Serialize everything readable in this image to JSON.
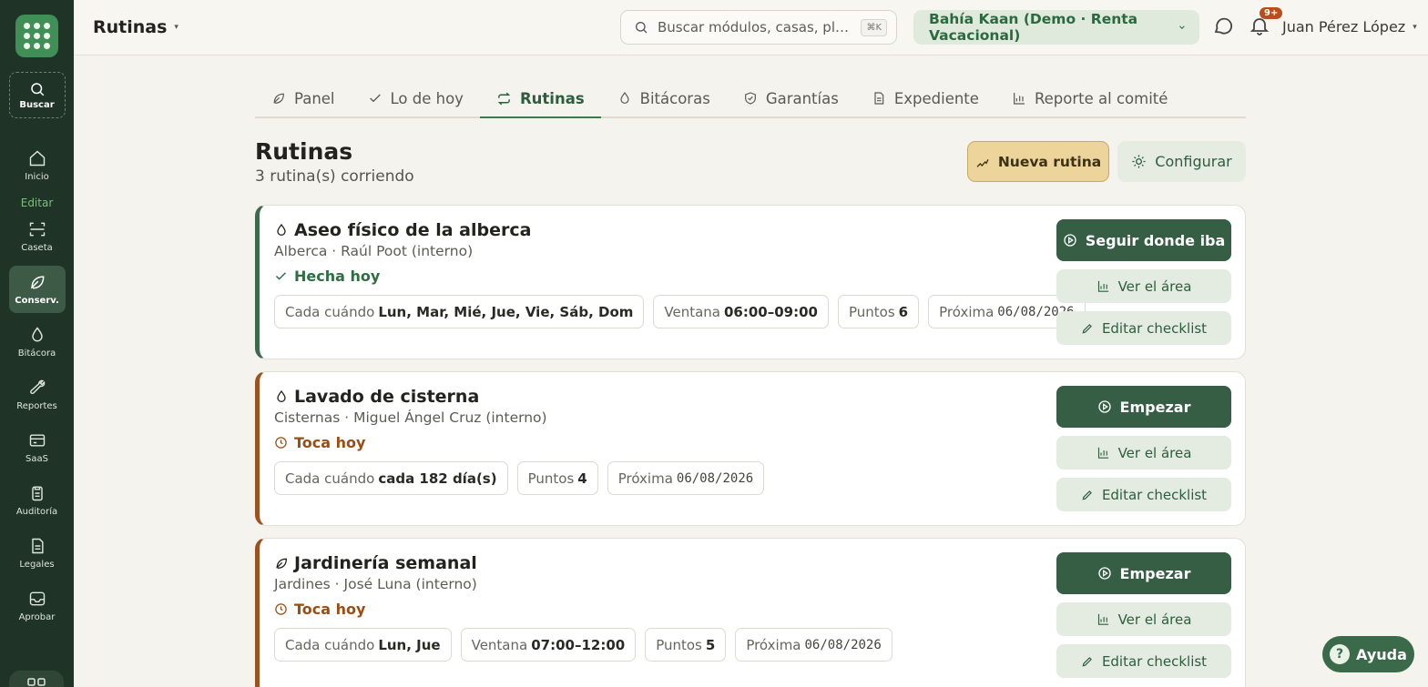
{
  "topbar": {
    "title": "Rutinas",
    "search_placeholder": "Buscar módulos, casas, placas…",
    "search_shortcut": "⌘K",
    "property": "Bahía Kaan (Demo · Renta Vacacional)",
    "notifications_badge": "9+",
    "user_name": "Juan Pérez López"
  },
  "sidebar": {
    "search_label": "Buscar",
    "section_label": "Editar",
    "items": [
      {
        "label": "Inicio",
        "icon": "home-icon"
      },
      {
        "label": "Caseta",
        "icon": "scan-icon"
      },
      {
        "label": "Conserv.",
        "icon": "leaf-icon",
        "active": true
      },
      {
        "label": "Bitácora",
        "icon": "drop-icon"
      },
      {
        "label": "Reportes",
        "icon": "wrench-icon"
      },
      {
        "label": "SaaS",
        "icon": "card-icon"
      },
      {
        "label": "Auditoría",
        "icon": "clipboard-icon"
      },
      {
        "label": "Legales",
        "icon": "document-icon"
      },
      {
        "label": "Aprobar",
        "icon": "inbox-icon"
      }
    ]
  },
  "tabs": [
    {
      "label": "Panel",
      "icon": "leaf-icon"
    },
    {
      "label": "Lo de hoy",
      "icon": "check-icon"
    },
    {
      "label": "Rutinas",
      "icon": "repeat-icon",
      "active": true
    },
    {
      "label": "Bitácoras",
      "icon": "drop-icon"
    },
    {
      "label": "Garantías",
      "icon": "shield-icon"
    },
    {
      "label": "Expediente",
      "icon": "document-icon"
    },
    {
      "label": "Reporte al comité",
      "icon": "bar-chart-icon"
    }
  ],
  "header": {
    "title": "Rutinas",
    "subtitle": "3 rutina(s) corriendo",
    "new_button": "Nueva rutina",
    "config_button": "Configurar"
  },
  "routines": [
    {
      "title": "Aseo físico de la alberca",
      "subtitle": "Alberca · Raúl Poot (interno)",
      "status": "Hecha hoy",
      "status_kind": "done",
      "freq_label": "Cada cuándo",
      "freq_value": "Lun, Mar, Mié, Jue, Vie, Sáb, Dom",
      "window_label": "Ventana",
      "window_value": "06:00–09:00",
      "points_label": "Puntos",
      "points_value": "6",
      "next_label": "Próxima",
      "next_value": "06/08/2026",
      "primary_action": "Seguir donde iba",
      "area_action": "Ver el área",
      "checklist_action": "Editar checklist"
    },
    {
      "title": "Lavado de cisterna",
      "subtitle": "Cisternas · Miguel Ángel Cruz (interno)",
      "status": "Toca hoy",
      "status_kind": "due",
      "freq_label": "Cada cuándo",
      "freq_value": "cada 182 día(s)",
      "points_label": "Puntos",
      "points_value": "4",
      "next_label": "Próxima",
      "next_value": "06/08/2026",
      "primary_action": "Empezar",
      "area_action": "Ver el área",
      "checklist_action": "Editar checklist"
    },
    {
      "title": "Jardinería semanal",
      "subtitle": "Jardines · José Luna (interno)",
      "status": "Toca hoy",
      "status_kind": "due",
      "freq_label": "Cada cuándo",
      "freq_value": "Lun, Jue",
      "window_label": "Ventana",
      "window_value": "07:00–12:00",
      "points_label": "Puntos",
      "points_value": "5",
      "next_label": "Próxima",
      "next_value": "06/08/2026",
      "primary_action": "Empezar",
      "area_action": "Ver el área",
      "checklist_action": "Editar checklist"
    }
  ],
  "help": {
    "label": "Ayuda"
  },
  "colors": {
    "sidebar_bg": "#1f3326",
    "accent_green": "#355e45",
    "status_done": "#2f6e42",
    "status_due": "#9c4d12",
    "new_button_bg": "#ecd49a"
  }
}
